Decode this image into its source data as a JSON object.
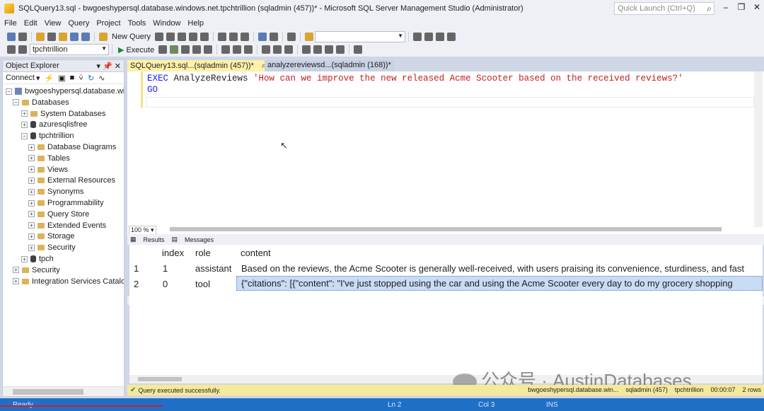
{
  "window": {
    "title": "SQLQuery13.sql - bwgoeshypersql.database.windows.net.tpchtrillion (sqladmin (457))* - Microsoft SQL Server Management Studio (Administrator)",
    "quick_launch_placeholder": "Quick Launch (Ctrl+Q)"
  },
  "menu": [
    "File",
    "Edit",
    "View",
    "Query",
    "Project",
    "Tools",
    "Window",
    "Help"
  ],
  "toolbar": {
    "new_query": "New Query",
    "database": "tpchtrillion",
    "execute": "Execute"
  },
  "object_explorer": {
    "title": "Object Explorer",
    "connect": "Connect",
    "tree": [
      {
        "label": "bwgoeshypersql.database.windo",
        "level": 0,
        "kind": "server",
        "expander": "−"
      },
      {
        "label": "Databases",
        "level": 1,
        "kind": "folder",
        "expander": "−"
      },
      {
        "label": "System Databases",
        "level": 2,
        "kind": "folder",
        "expander": "+"
      },
      {
        "label": "azuresqlisfree",
        "level": 2,
        "kind": "db",
        "expander": "+"
      },
      {
        "label": "tpchtrillion",
        "level": 2,
        "kind": "db",
        "expander": "−"
      },
      {
        "label": "Database Diagrams",
        "level": 3,
        "kind": "folder",
        "expander": "+"
      },
      {
        "label": "Tables",
        "level": 3,
        "kind": "folder",
        "expander": "+"
      },
      {
        "label": "Views",
        "level": 3,
        "kind": "folder",
        "expander": "+"
      },
      {
        "label": "External Resources",
        "level": 3,
        "kind": "folder",
        "expander": "+"
      },
      {
        "label": "Synonyms",
        "level": 3,
        "kind": "folder",
        "expander": "+"
      },
      {
        "label": "Programmability",
        "level": 3,
        "kind": "folder",
        "expander": "+"
      },
      {
        "label": "Query Store",
        "level": 3,
        "kind": "folder",
        "expander": "+"
      },
      {
        "label": "Extended Events",
        "level": 3,
        "kind": "folder",
        "expander": "+"
      },
      {
        "label": "Storage",
        "level": 3,
        "kind": "folder",
        "expander": "+"
      },
      {
        "label": "Security",
        "level": 3,
        "kind": "folder",
        "expander": "+"
      },
      {
        "label": "tpch",
        "level": 2,
        "kind": "db",
        "expander": "+"
      },
      {
        "label": "Security",
        "level": 1,
        "kind": "folder",
        "expander": "+"
      },
      {
        "label": "Integration Services Catalogs",
        "level": 1,
        "kind": "folder",
        "expander": "+"
      }
    ]
  },
  "tabs": [
    {
      "label": "SQLQuery13.sql...(sqladmin (457))*",
      "active": true
    },
    {
      "label": "analyzereviewsd...(sqladmin (168))*",
      "active": false
    }
  ],
  "editor": {
    "line1_kw": "EXEC",
    "line1_proc": " AnalyzeReviews ",
    "line1_str": "'How can we improve the new released Acme Scooter based on the received reviews?'",
    "line2_kw": "GO",
    "zoom": "100 %"
  },
  "results": {
    "tab_results": "Results",
    "tab_messages": "Messages",
    "columns": [
      "index",
      "role",
      "content"
    ],
    "rows": [
      {
        "num": "1",
        "index": "1",
        "role": "assistant",
        "content": "Based on the reviews, the Acme Scooter is generally well-received, with users praising its convenience, sturdiness, and fast"
      },
      {
        "num": "2",
        "index": "0",
        "role": "tool",
        "content": "{\"citations\": [{\"content\": \"I've just stopped using the car and using the Acme Scooter every day to do my grocery shopping"
      }
    ]
  },
  "query_status": {
    "message": "Query executed successfully.",
    "server": "bwgoeshypersql.database.win...",
    "user": "sqladmin (457)",
    "db": "tpchtrillion",
    "time": "00:00:07",
    "rows": "2 rows"
  },
  "status_bar": {
    "ready": "Ready",
    "ln": "Ln 2",
    "col": "Col 3",
    "ins": "INS"
  },
  "watermark": "公众号 · AustinDatabases"
}
